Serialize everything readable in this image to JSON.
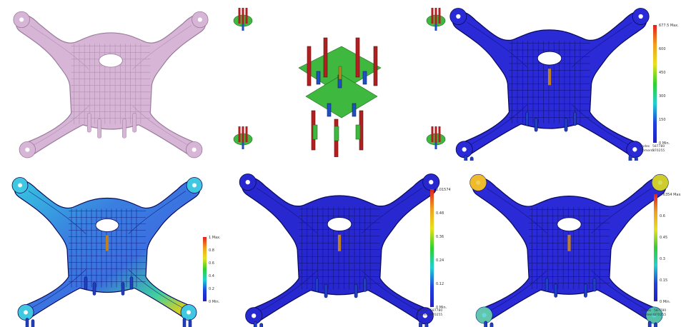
{
  "panels": [
    {
      "name": "topology-optimized-frame",
      "style": "mesh",
      "color": "#d7b5d6"
    },
    {
      "name": "boundary-conditions",
      "style": "bc"
    },
    {
      "name": "stress-result",
      "style": "mesh",
      "color": "#2a2ad6",
      "legend": {
        "labels": [
          "677.5 Max.",
          "600",
          "450",
          "300",
          "150",
          "0 Min."
        ]
      },
      "stats": {
        "nodes_label": "Nodes",
        "nodes_value": "587780",
        "elements_label": "Elements",
        "elements_value": "370255"
      }
    },
    {
      "name": "displacement-result",
      "style": "gradient",
      "legend": {
        "labels": [
          "1 Max.",
          "0.8",
          "0.6",
          "0.4",
          "0.2",
          "0 Min."
        ]
      }
    },
    {
      "name": "strain-result",
      "style": "mesh",
      "color": "#2828d0",
      "legend": {
        "labels": [
          "0.01574",
          "0.48",
          "0.36",
          "0.24",
          "0.12",
          "0 Min."
        ]
      },
      "stats": {
        "nodes_label": "Nodes",
        "nodes_value": "587780",
        "elements_label": "Elements",
        "elements_value": "370255"
      }
    },
    {
      "name": "safety-result",
      "style": "mesh-hot",
      "color": "#2a2ad6",
      "legend": {
        "labels": [
          "0.6354 Max.",
          "0.6",
          "0.45",
          "0.3",
          "0.15",
          "0 Min."
        ]
      },
      "stats": {
        "nodes_label": "Nodes",
        "nodes_value": "587780",
        "elements_label": "Elements",
        "elements_value": "370255"
      }
    }
  ],
  "colors": {
    "frame_pink": "#d7b5d6",
    "mesh_blue": "#2a2ad6",
    "bc_green": "#3fb83f",
    "bc_red": "#b02020",
    "bc_blue": "#2050c0"
  }
}
